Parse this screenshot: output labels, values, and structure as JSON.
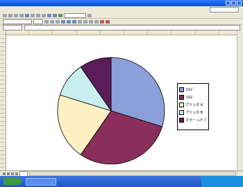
{
  "window": {
    "title": ""
  },
  "menu": {
    "items": [
      "",
      "",
      "",
      "",
      "",
      "",
      "",
      "",
      ""
    ]
  },
  "sheet": {
    "active_tab": ""
  },
  "chart_data": {
    "type": "pie",
    "title": "",
    "series": [
      {
        "name": "",
        "values": [
          31,
          31,
          21,
          11,
          10
        ]
      }
    ],
    "categories": [
      "ﾌﾛﾛﾋﾟ",
      "ﾌﾛﾛﾛ",
      "プリンタ A",
      "プリンタ B",
      "カラー ﾚｰｻﾞﾌﾟ"
    ],
    "colors": [
      "#8b9fd9",
      "#8a2f5c",
      "#fdf0c2",
      "#c9eef0",
      "#5b1d57"
    ],
    "legend": "right"
  }
}
